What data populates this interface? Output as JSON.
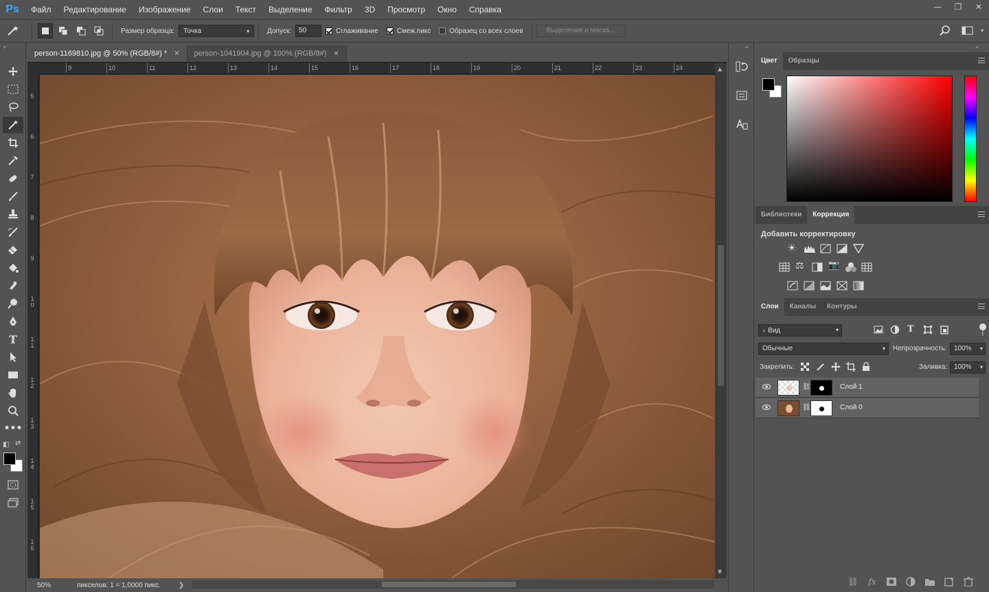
{
  "app": {
    "logo": "Ps"
  },
  "menu": [
    "Файл",
    "Редактирование",
    "Изображение",
    "Слои",
    "Текст",
    "Выделение",
    "Фильтр",
    "3D",
    "Просмотр",
    "Окно",
    "Справка"
  ],
  "window_controls": {
    "minimize": "—",
    "restore": "❐",
    "close": "✕"
  },
  "options": {
    "sample_size_label": "Размер образца:",
    "sample_size_value": "Точка",
    "tolerance_label": "Допуск:",
    "tolerance_value": "50",
    "antialias_label": "Сглаживание",
    "contiguous_label": "Смеж.пикс",
    "sample_all_label": "Образец со всех слоев",
    "select_mask_label": "Выделение и маска..."
  },
  "tabs": [
    {
      "label": "person-1169810.jpg @ 50% (RGB/8#) *",
      "close": "✕"
    },
    {
      "label": "person-1041904.jpg @ 100% (RGB/8#)",
      "close": "✕"
    }
  ],
  "ruler_top": [
    "9",
    "10",
    "11",
    "12",
    "13",
    "14",
    "15",
    "16",
    "17",
    "18",
    "19",
    "20",
    "21",
    "22",
    "23",
    "24"
  ],
  "ruler_left": [
    "5",
    "6",
    "7",
    "8",
    "9",
    "1 0",
    "1 1",
    "1 2",
    "1 3",
    "1 4",
    "1 5",
    "1 6"
  ],
  "status": {
    "zoom": "50%",
    "info": "пикселов: 1 = 1,0000 пикс.",
    "arrow": "❯"
  },
  "color_panel": {
    "tabs": [
      "Цвет",
      "Образцы"
    ],
    "fg": "#000000",
    "bg": "#ffffff"
  },
  "adjust_panel": {
    "tabs": [
      "Библиотеки",
      "Коррекция"
    ],
    "title": "Добавить корректировку"
  },
  "layers_panel": {
    "tabs": [
      "Слои",
      "Каналы",
      "Контуры"
    ],
    "filter_value": "Вид",
    "blend_mode": "Обычные",
    "opacity_label": "Непрозрачность:",
    "opacity_value": "100%",
    "lock_label": "Закрепить:",
    "fill_label": "Заливка:",
    "fill_value": "100%",
    "layers": [
      {
        "name": "Слой 1"
      },
      {
        "name": "Слой 0"
      }
    ]
  }
}
